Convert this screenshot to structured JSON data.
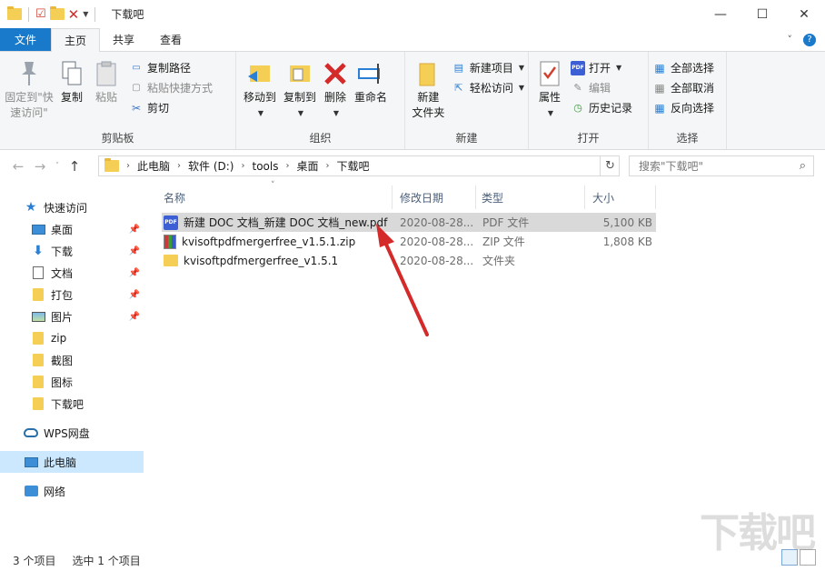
{
  "window": {
    "title": "下载吧",
    "minimize": "—",
    "maximize": "☐",
    "close": "✕"
  },
  "tabs": [
    {
      "label": "文件"
    },
    {
      "label": "主页"
    },
    {
      "label": "共享"
    },
    {
      "label": "查看"
    }
  ],
  "ribbon": {
    "clipboard": {
      "label": "剪贴板",
      "pin_quick": "固定到\"快\n速访问\"",
      "copy": "复制",
      "paste": "粘贴",
      "copy_path": "复制路径",
      "paste_shortcut": "粘贴快捷方式",
      "cut": "剪切"
    },
    "organize": {
      "label": "组织",
      "move_to": "移动到",
      "copy_to": "复制到",
      "delete": "删除",
      "rename": "重命名"
    },
    "new": {
      "label": "新建",
      "new_folder": "新建\n文件夹",
      "new_item": "新建项目",
      "easy_access": "轻松访问"
    },
    "open": {
      "label": "打开",
      "properties": "属性",
      "open": "打开",
      "edit": "编辑",
      "history": "历史记录"
    },
    "select": {
      "label": "选择",
      "select_all": "全部选择",
      "select_none": "全部取消",
      "invert": "反向选择"
    }
  },
  "address": {
    "crumbs": [
      "此电脑",
      "软件 (D:)",
      "tools",
      "桌面",
      "下载吧"
    ],
    "search_placeholder": "搜索\"下载吧\""
  },
  "nav": {
    "quick_access": "快速访问",
    "items": [
      {
        "label": "桌面",
        "pinned": true
      },
      {
        "label": "下载",
        "pinned": true
      },
      {
        "label": "文档",
        "pinned": true
      },
      {
        "label": "打包",
        "pinned": true
      },
      {
        "label": "图片",
        "pinned": true
      },
      {
        "label": "zip",
        "pinned": false
      },
      {
        "label": "截图",
        "pinned": false
      },
      {
        "label": "图标",
        "pinned": false
      },
      {
        "label": "下载吧",
        "pinned": false
      }
    ],
    "wps": "WPS网盘",
    "this_pc": "此电脑",
    "network": "网络"
  },
  "columns": {
    "name": "名称",
    "modified": "修改日期",
    "type": "类型",
    "size": "大小"
  },
  "files": [
    {
      "name": "新建 DOC 文档_新建 DOC 文档_new.pdf",
      "modified": "2020-08-28...",
      "type": "PDF 文件",
      "size": "5,100 KB",
      "icon": "pdf-icon",
      "selected": true
    },
    {
      "name": "kvisoftpdfmergerfree_v1.5.1.zip",
      "modified": "2020-08-28...",
      "type": "ZIP 文件",
      "size": "1,808 KB",
      "icon": "zip-icon",
      "selected": false
    },
    {
      "name": "kvisoftpdfmergerfree_v1.5.1",
      "modified": "2020-08-28...",
      "type": "文件夹",
      "size": "",
      "icon": "folder-icon",
      "selected": false
    }
  ],
  "status": {
    "count": "3 个项目",
    "selected": "选中 1 个项目"
  },
  "watermark": "下载吧",
  "colors": {
    "accent": "#1979ca",
    "selection": "#d9d9d9",
    "arrow": "#d42a2a"
  }
}
